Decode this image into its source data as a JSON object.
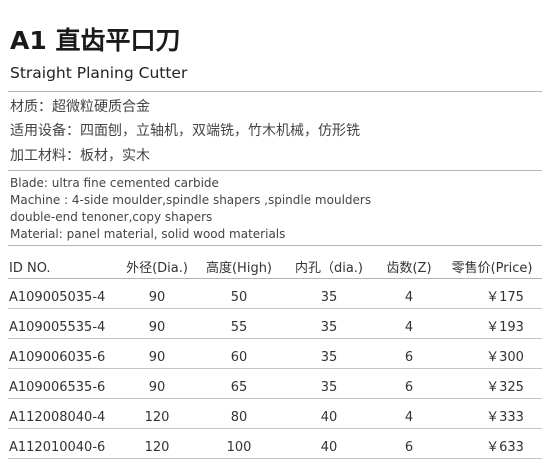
{
  "header": {
    "title": "A1 直齿平口刀",
    "subtitle": "Straight Planing Cutter"
  },
  "details_cn": [
    "材质：超微粒硬质合金",
    "适用设备：四面刨，立轴机，双端铣，竹木机械，仿形铣",
    "加工材料：板材，实木"
  ],
  "details_en": [
    "Blade: ultra fine cemented carbide",
    "Machine : 4-side moulder,spindle shapers ,spindle moulders",
    "double-end tenoner,copy shapers",
    "Material: panel material, solid wood materials"
  ],
  "table": {
    "headers": [
      "ID NO.",
      "外径(Dia.)",
      "高度(High)",
      "内孔（dia.)",
      "齿数(Z)",
      "零售价(Price)"
    ],
    "rows": [
      [
        "A109005035-4",
        "90",
        "50",
        "35",
        "4",
        "￥175"
      ],
      [
        "A109005535-4",
        "90",
        "55",
        "35",
        "4",
        "￥193"
      ],
      [
        "A109006035-6",
        "90",
        "60",
        "35",
        "6",
        "￥300"
      ],
      [
        "A109006535-6",
        "90",
        "65",
        "35",
        "6",
        "￥325"
      ],
      [
        "A112008040-4",
        "120",
        "80",
        "40",
        "4",
        "￥333"
      ],
      [
        "A112010040-6",
        "120",
        "100",
        "40",
        "6",
        "￥633"
      ]
    ]
  }
}
